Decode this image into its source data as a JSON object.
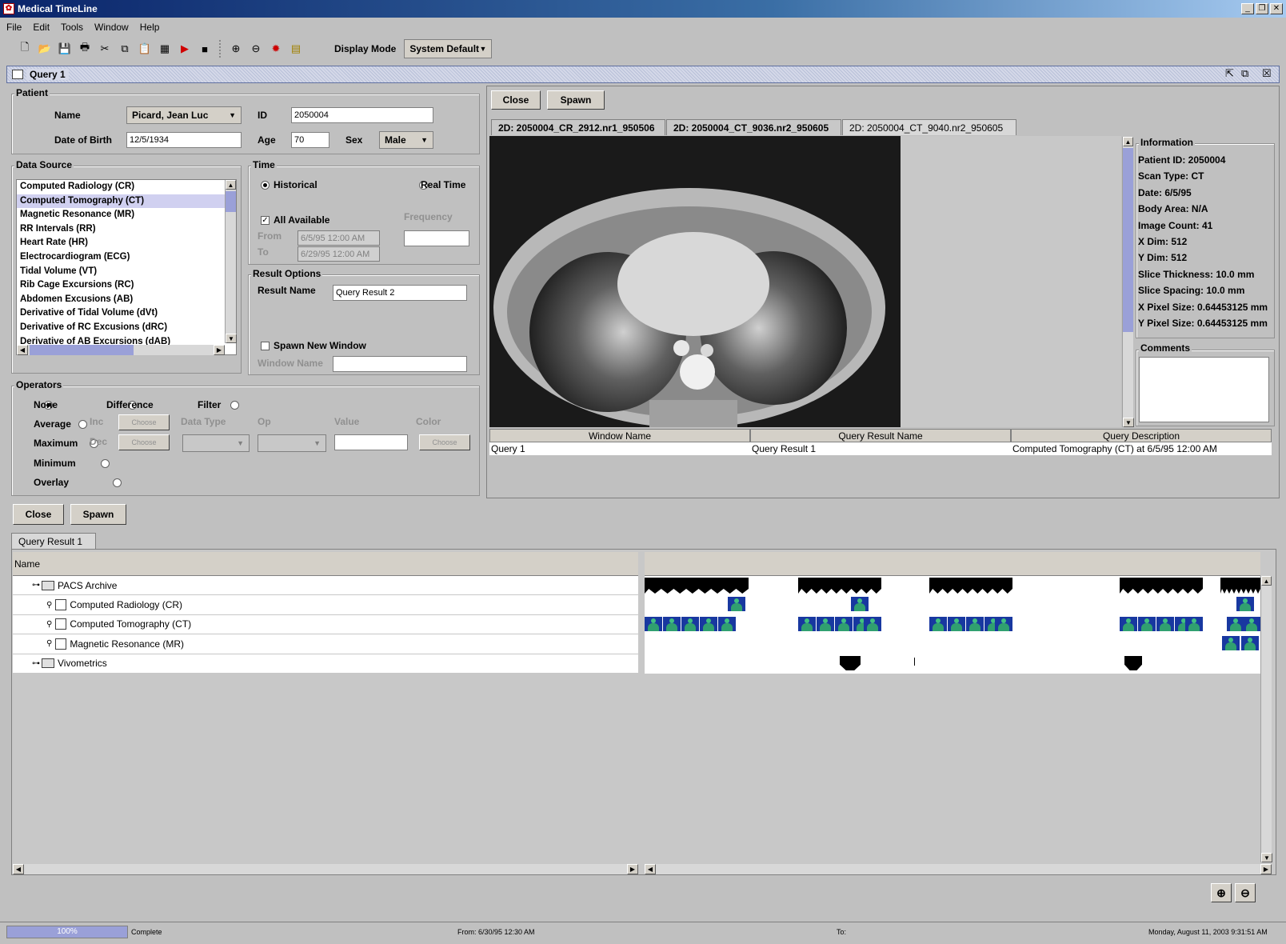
{
  "window": {
    "title": "Medical TimeLine"
  },
  "menu": [
    "File",
    "Edit",
    "Tools",
    "Window",
    "Help"
  ],
  "toolbar": {
    "display_mode_label": "Display Mode",
    "display_mode_value": "System Default"
  },
  "internal": {
    "title": "Query 1"
  },
  "patient": {
    "group": "Patient",
    "name_label": "Name",
    "name_value": "Picard, Jean Luc",
    "id_label": "ID",
    "id_value": "2050004",
    "dob_label": "Date of Birth",
    "dob_value": "12/5/1934",
    "age_label": "Age",
    "age_value": "70",
    "sex_label": "Sex",
    "sex_value": "Male"
  },
  "datasource": {
    "group": "Data Source",
    "items": [
      "Computed Radiology (CR)",
      "Computed Tomography (CT)",
      "Magnetic Resonance (MR)",
      "RR Intervals (RR)",
      "Heart Rate (HR)",
      "Electrocardiogram (ECG)",
      "Tidal Volume (VT)",
      "Rib Cage Excursions (RC)",
      "Abdomen Excusions (AB)",
      "Derivative of Tidal Volume (dVt)",
      "Derivative of RC Excusions (dRC)",
      "Derivative of AB Excursions (dAB)"
    ],
    "selected": 1
  },
  "time": {
    "group": "Time",
    "historical": "Historical",
    "realtime": "Real Time",
    "all_available": "All Available",
    "frequency": "Frequency",
    "from_label": "From",
    "from_value": "6/5/95 12:00 AM",
    "to_label": "To",
    "to_value": "6/29/95 12:00 AM"
  },
  "result": {
    "group": "Result Options",
    "name_label": "Result Name",
    "name_value": "Query Result 2",
    "spawn": "Spawn New Window",
    "window_name": "Window Name"
  },
  "operators": {
    "group": "Operators",
    "none": "None",
    "average": "Average",
    "maximum": "Maximum",
    "minimum": "Minimum",
    "overlay": "Overlay",
    "difference": "Difference",
    "filter": "Filter",
    "inc": "Inc",
    "dec": "Dec",
    "choose": "Choose",
    "data_type": "Data Type",
    "op": "Op",
    "value": "Value",
    "color": "Color"
  },
  "viewer": {
    "close": "Close",
    "spawn": "Spawn",
    "tabs": [
      "2D: 2050004_CR_2912.nr1_950506",
      "2D: 2050004_CT_9036.nr2_950605",
      "2D: 2050004_CT_9040.nr2_950605"
    ],
    "active_tab": 2
  },
  "info": {
    "group": "Information",
    "lines": [
      "Patient ID: 2050004",
      "Scan Type: CT",
      "Date: 6/5/95",
      "Body Area: N/A",
      "Image Count: 41",
      "X Dim: 512",
      "Y Dim: 512",
      "Slice Thickness: 10.0 mm",
      "Slice Spacing: 10.0 mm",
      "X Pixel Size: 0.64453125 mm",
      "Y Pixel Size: 0.64453125 mm"
    ],
    "comments": "Comments"
  },
  "results_table": {
    "headers": [
      "Window Name",
      "Query Result Name",
      "Query Description"
    ],
    "row": [
      "Query 1",
      "Query Result 1",
      "Computed Tomography (CT) at 6/5/95 12:00 AM"
    ]
  },
  "bottom": {
    "close": "Close",
    "spawn": "Spawn",
    "tab": "Query Result 1",
    "name_header": "Name",
    "tree": [
      "PACS Archive",
      "Computed Radiology (CR)",
      "Computed Tomography (CT)",
      "Magnetic Resonance (MR)",
      "Vivometrics"
    ]
  },
  "statusbar": {
    "progress": "100%",
    "progress_value": 1.0,
    "state": "Complete",
    "from": "From:  6/30/95 12:30 AM",
    "to": "To:",
    "datetime": "Monday, August 11, 2003 9:31:51 AM"
  }
}
